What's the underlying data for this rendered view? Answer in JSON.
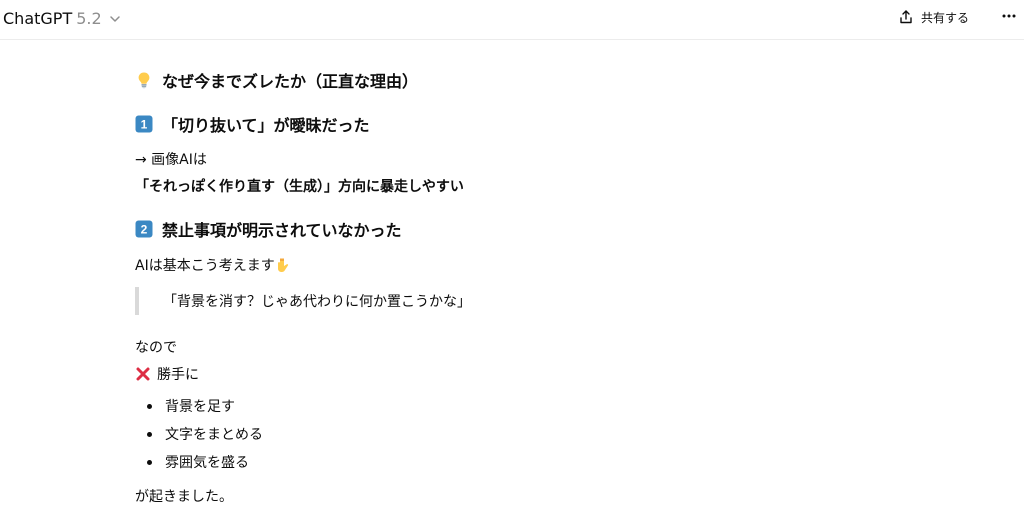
{
  "header": {
    "model_name": "ChatGPT",
    "model_version": "5.2",
    "share_label": "共有する"
  },
  "message": {
    "title": "なぜ今までズレたか（正直な理由）",
    "section1": {
      "heading": "「切り抜いて」が曖昧だった",
      "arrow_line": "→ 画像AIは",
      "bold_line": "「それっぽく作り直す（生成）」方向に暴走しやすい"
    },
    "section2": {
      "heading": "禁止事項が明示されていなかった",
      "intro": "AIは基本こう考えます",
      "quote": "「背景を消す？じゃあ代わりに何か置こうかな」",
      "so_line": "なので",
      "x_line": "勝手に",
      "bullets": [
        "背景を足す",
        "文字をまとめる",
        "雰囲気を盛る"
      ],
      "conclusion": "が起きました。"
    }
  },
  "icons": {
    "title": "lightbulb-icon",
    "section1": "keycap-1-icon",
    "section2": "keycap-2-icon",
    "intro": "pointing-down-icon",
    "x_line": "cross-mark-icon"
  },
  "colors": {
    "keycap": "#3b88c3",
    "cross": "#dd2e44",
    "bulb": "#ffcc4d",
    "muted": "#8e8e8e",
    "quote_border": "#d9d9d9"
  }
}
